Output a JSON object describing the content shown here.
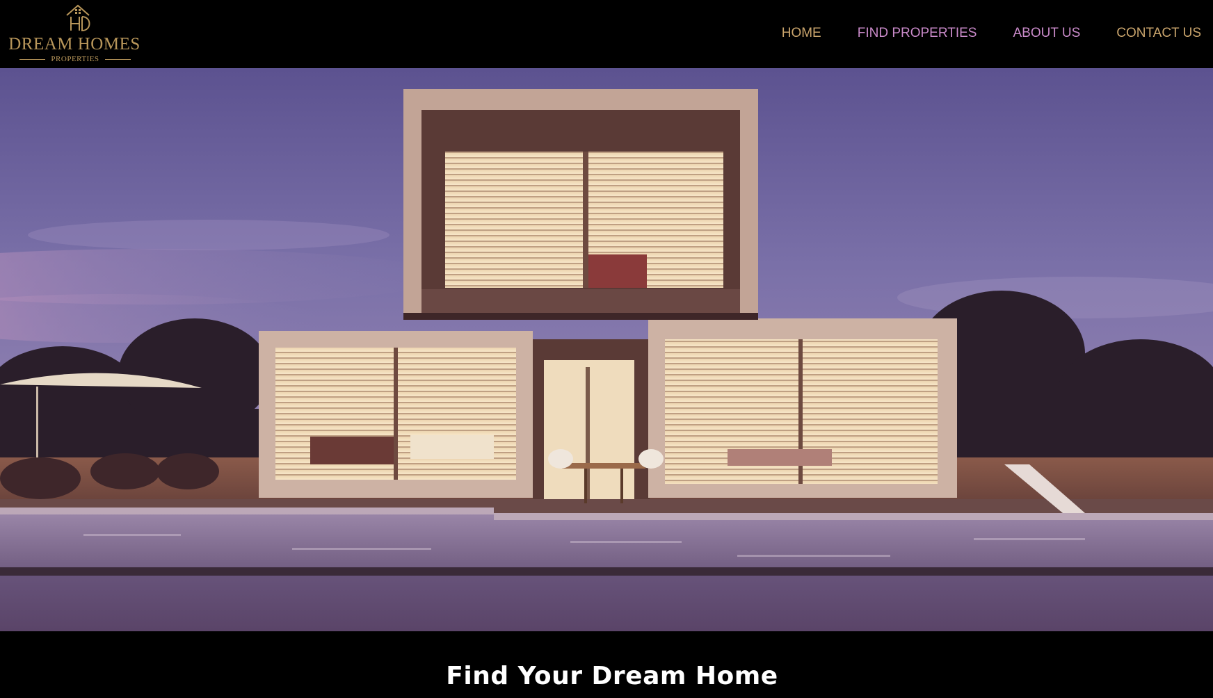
{
  "brand": {
    "logo_icon": "house-monogram-icon",
    "name": "DREAM HOMES",
    "subtitle": "PROPERTIES",
    "color": "#b8965a"
  },
  "nav": {
    "items": [
      {
        "label": "HOME",
        "color": "#c9a46c"
      },
      {
        "label": "FIND PROPERTIES",
        "color": "#c98ac9"
      },
      {
        "label": "ABOUT US",
        "color": "#c98ac9"
      },
      {
        "label": "CONTACT US",
        "color": "#c9a46c"
      }
    ]
  },
  "hero": {
    "image": "modern-two-story-house-at-dusk-with-pool"
  },
  "headline": {
    "text": "Find Your Dream Home"
  },
  "colors": {
    "background": "#000000",
    "sky_top": "#5c5290",
    "warm_interior": "#f3dcb6"
  }
}
